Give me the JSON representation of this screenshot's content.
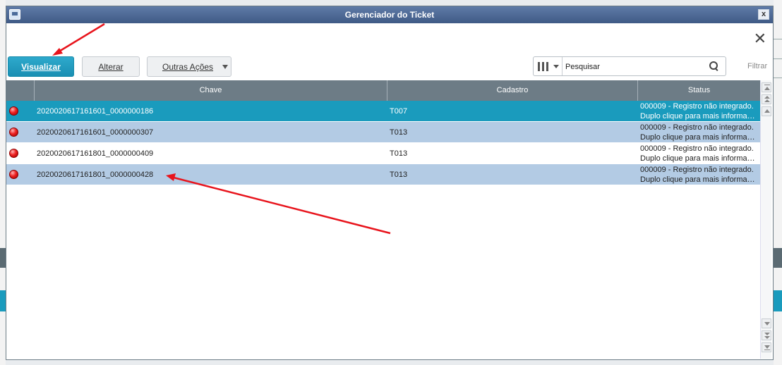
{
  "dialog": {
    "title": "Gerenciador do Ticket",
    "title_close": "x",
    "close_glyph": "✕"
  },
  "toolbar": {
    "visualizar": "Visualizar",
    "alterar": "Alterar",
    "outras_acoes": "Outras Ações",
    "search_value": "Pesquisar",
    "filtrar": "Filtrar"
  },
  "grid": {
    "columns": [
      "",
      "Chave",
      "Cadastro",
      "Status"
    ],
    "rows": [
      {
        "status_icon": "red-dot-icon",
        "chave": "2020020617161601_0000000186",
        "cadastro": "T007",
        "status_line1": "000009 - Registro não integrado.",
        "status_line2": "Duplo clique para mais informaç…",
        "selected": true
      },
      {
        "status_icon": "red-dot-icon",
        "chave": "2020020617161601_0000000307",
        "cadastro": "T013",
        "status_line1": "000009 - Registro não integrado.",
        "status_line2": "Duplo clique para mais informaç…",
        "selected": false
      },
      {
        "status_icon": "red-dot-icon",
        "chave": "2020020617161801_0000000409",
        "cadastro": "T013",
        "status_line1": "000009 - Registro não integrado.",
        "status_line2": "Duplo clique para mais informaç…",
        "selected": false
      },
      {
        "status_icon": "red-dot-icon",
        "chave": "2020020617161801_0000000428",
        "cadastro": "T013",
        "status_line1": "000009 - Registro não integrado.",
        "status_line2": "Duplo clique para mais informaç…",
        "selected": false
      }
    ]
  },
  "colors": {
    "accent": "#1a9bbd",
    "row_alt": "#b3cbe4",
    "header": "#6d7c86",
    "annotation": "#e8141c"
  },
  "icons": [
    "window-icon",
    "close-icon",
    "columns-icon",
    "search-icon",
    "red-dot-icon",
    "arrow-annotation-icon"
  ]
}
